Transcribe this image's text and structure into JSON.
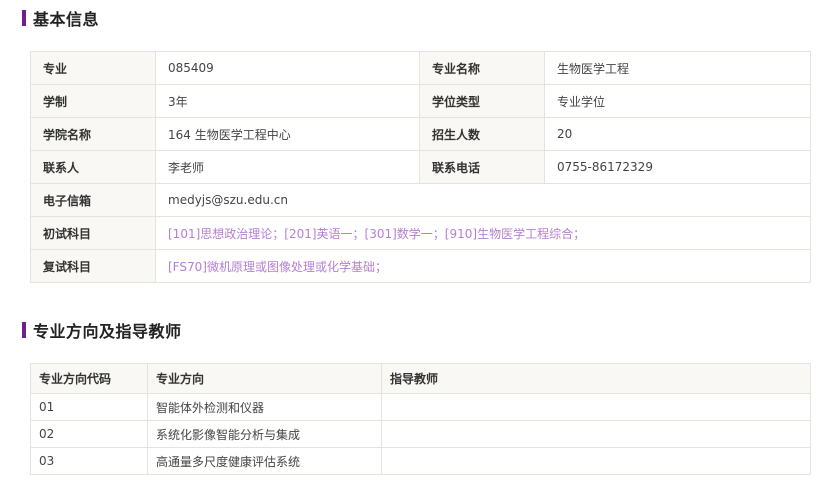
{
  "sections": {
    "basic_info_title": "基本信息",
    "direction_title": "专业方向及指导教师"
  },
  "basic_info": {
    "major_label": "专业",
    "major_value": "085409",
    "major_name_label": "专业名称",
    "major_name_value": "生物医学工程",
    "duration_label": "学制",
    "duration_value": "3年",
    "degree_type_label": "学位类型",
    "degree_type_value": "专业学位",
    "college_label": "学院名称",
    "college_value": "164 生物医学工程中心",
    "enrollment_label": "招生人数",
    "enrollment_value": "20",
    "contact_label": "联系人",
    "contact_value": "李老师",
    "phone_label": "联系电话",
    "phone_value": "0755-86172329",
    "email_label": "电子信箱",
    "email_value": "medyjs@szu.edu.cn",
    "prelim_label": "初试科目",
    "prelim_value": "[101]思想政治理论；[201]英语一；[301]数学一；[910]生物医学工程综合；",
    "retest_label": "复试科目",
    "retest_value": "[FS70]微机原理或图像处理或化学基础；"
  },
  "direction_table": {
    "headers": [
      "专业方向代码",
      "专业方向",
      "指导教师"
    ],
    "rows": [
      {
        "code": "01",
        "direction": "智能体外检测和仪器",
        "supervisor": ""
      },
      {
        "code": "02",
        "direction": "系统化影像智能分析与集成",
        "supervisor": ""
      },
      {
        "code": "03",
        "direction": "高通量多尺度健康评估系统",
        "supervisor": ""
      }
    ]
  },
  "colors": {
    "accent": "#6f1f8c",
    "link_purple": "#b57fd2",
    "label_bg": "#faf8f5",
    "border": "#e6e2dc"
  }
}
